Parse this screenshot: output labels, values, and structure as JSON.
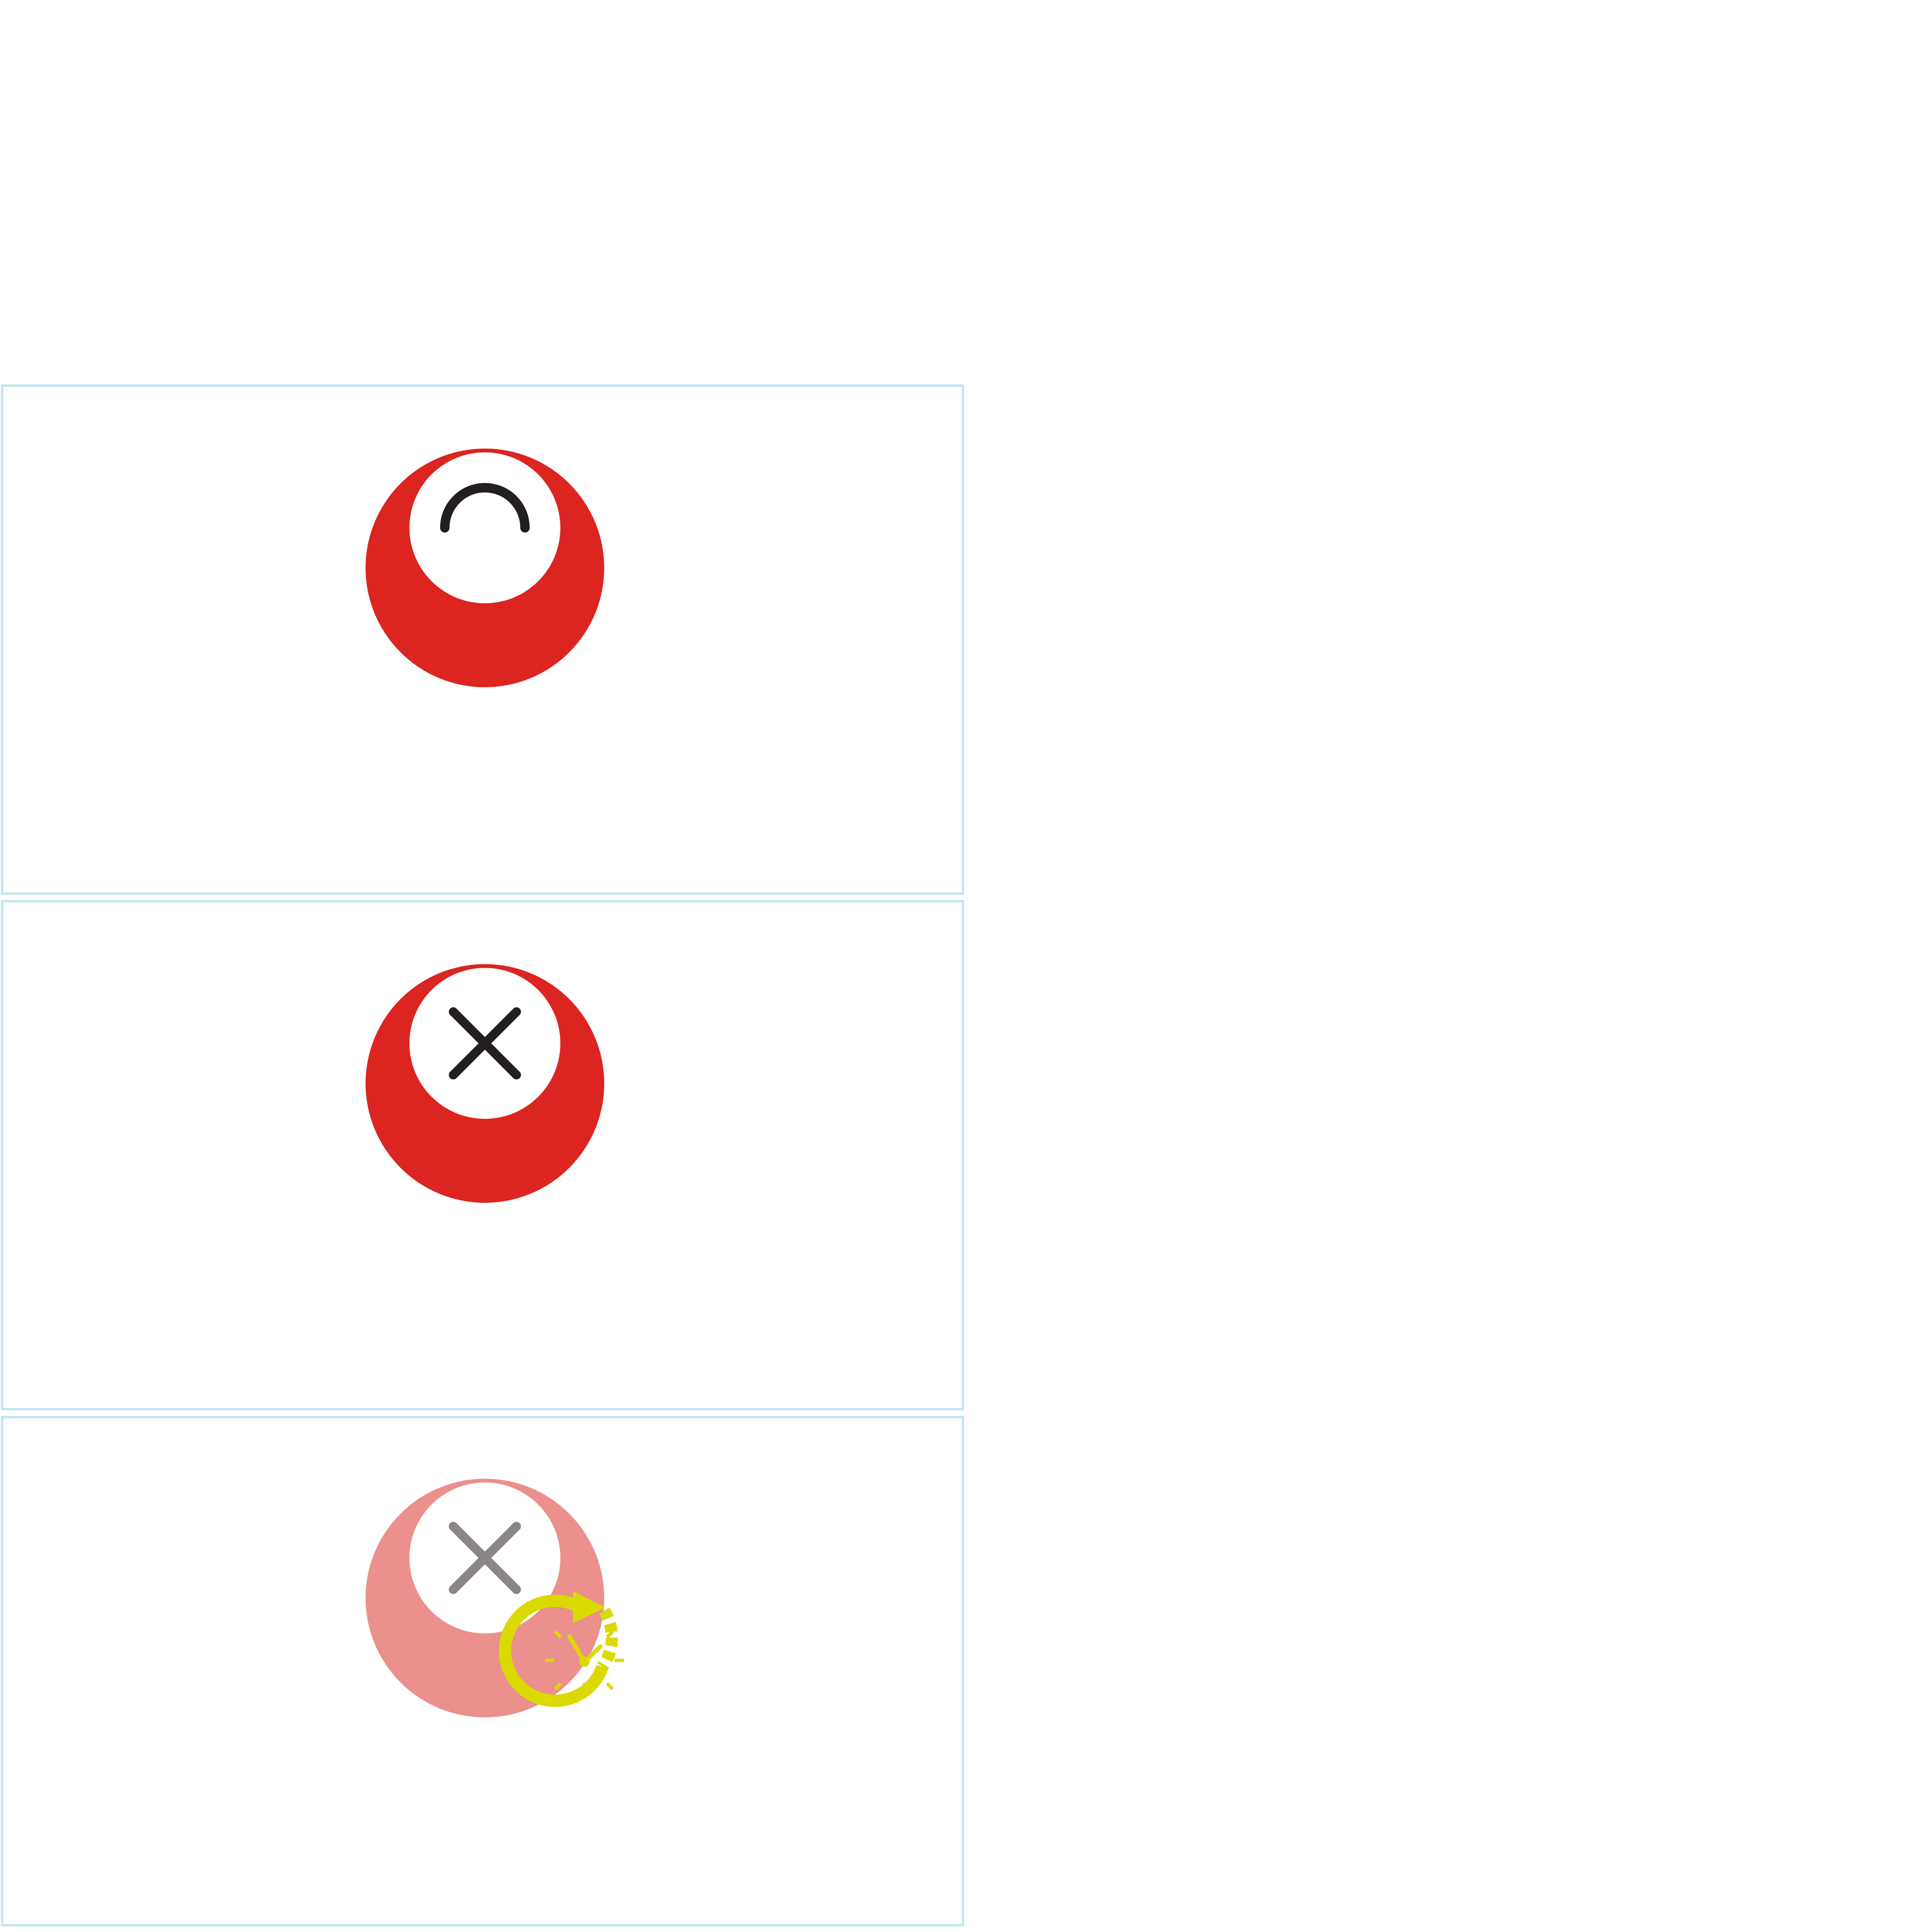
{
  "colors": {
    "background": "#ffffff",
    "panel_border": "#c5e6f2",
    "marker_red": "#dc2420",
    "marker_red_faded": "#eb908c",
    "inner_disc": "#ffffff",
    "glyph_dark": "#231f20",
    "glyph_faded": "#8b8585",
    "timer_yellow": "#dada00"
  },
  "panels": [
    {
      "state": "active",
      "icon": "arc-icon",
      "glyph_color": "#231f20",
      "disc_color": "#dc2420"
    },
    {
      "state": "closed",
      "icon": "close-icon",
      "glyph_color": "#231f20",
      "disc_color": "#dc2420"
    },
    {
      "state": "closed-scheduled",
      "icon": "close-icon",
      "glyph_color": "#8b8585",
      "disc_color": "#eb908c",
      "badge_icon": "clock-refresh-icon"
    }
  ]
}
